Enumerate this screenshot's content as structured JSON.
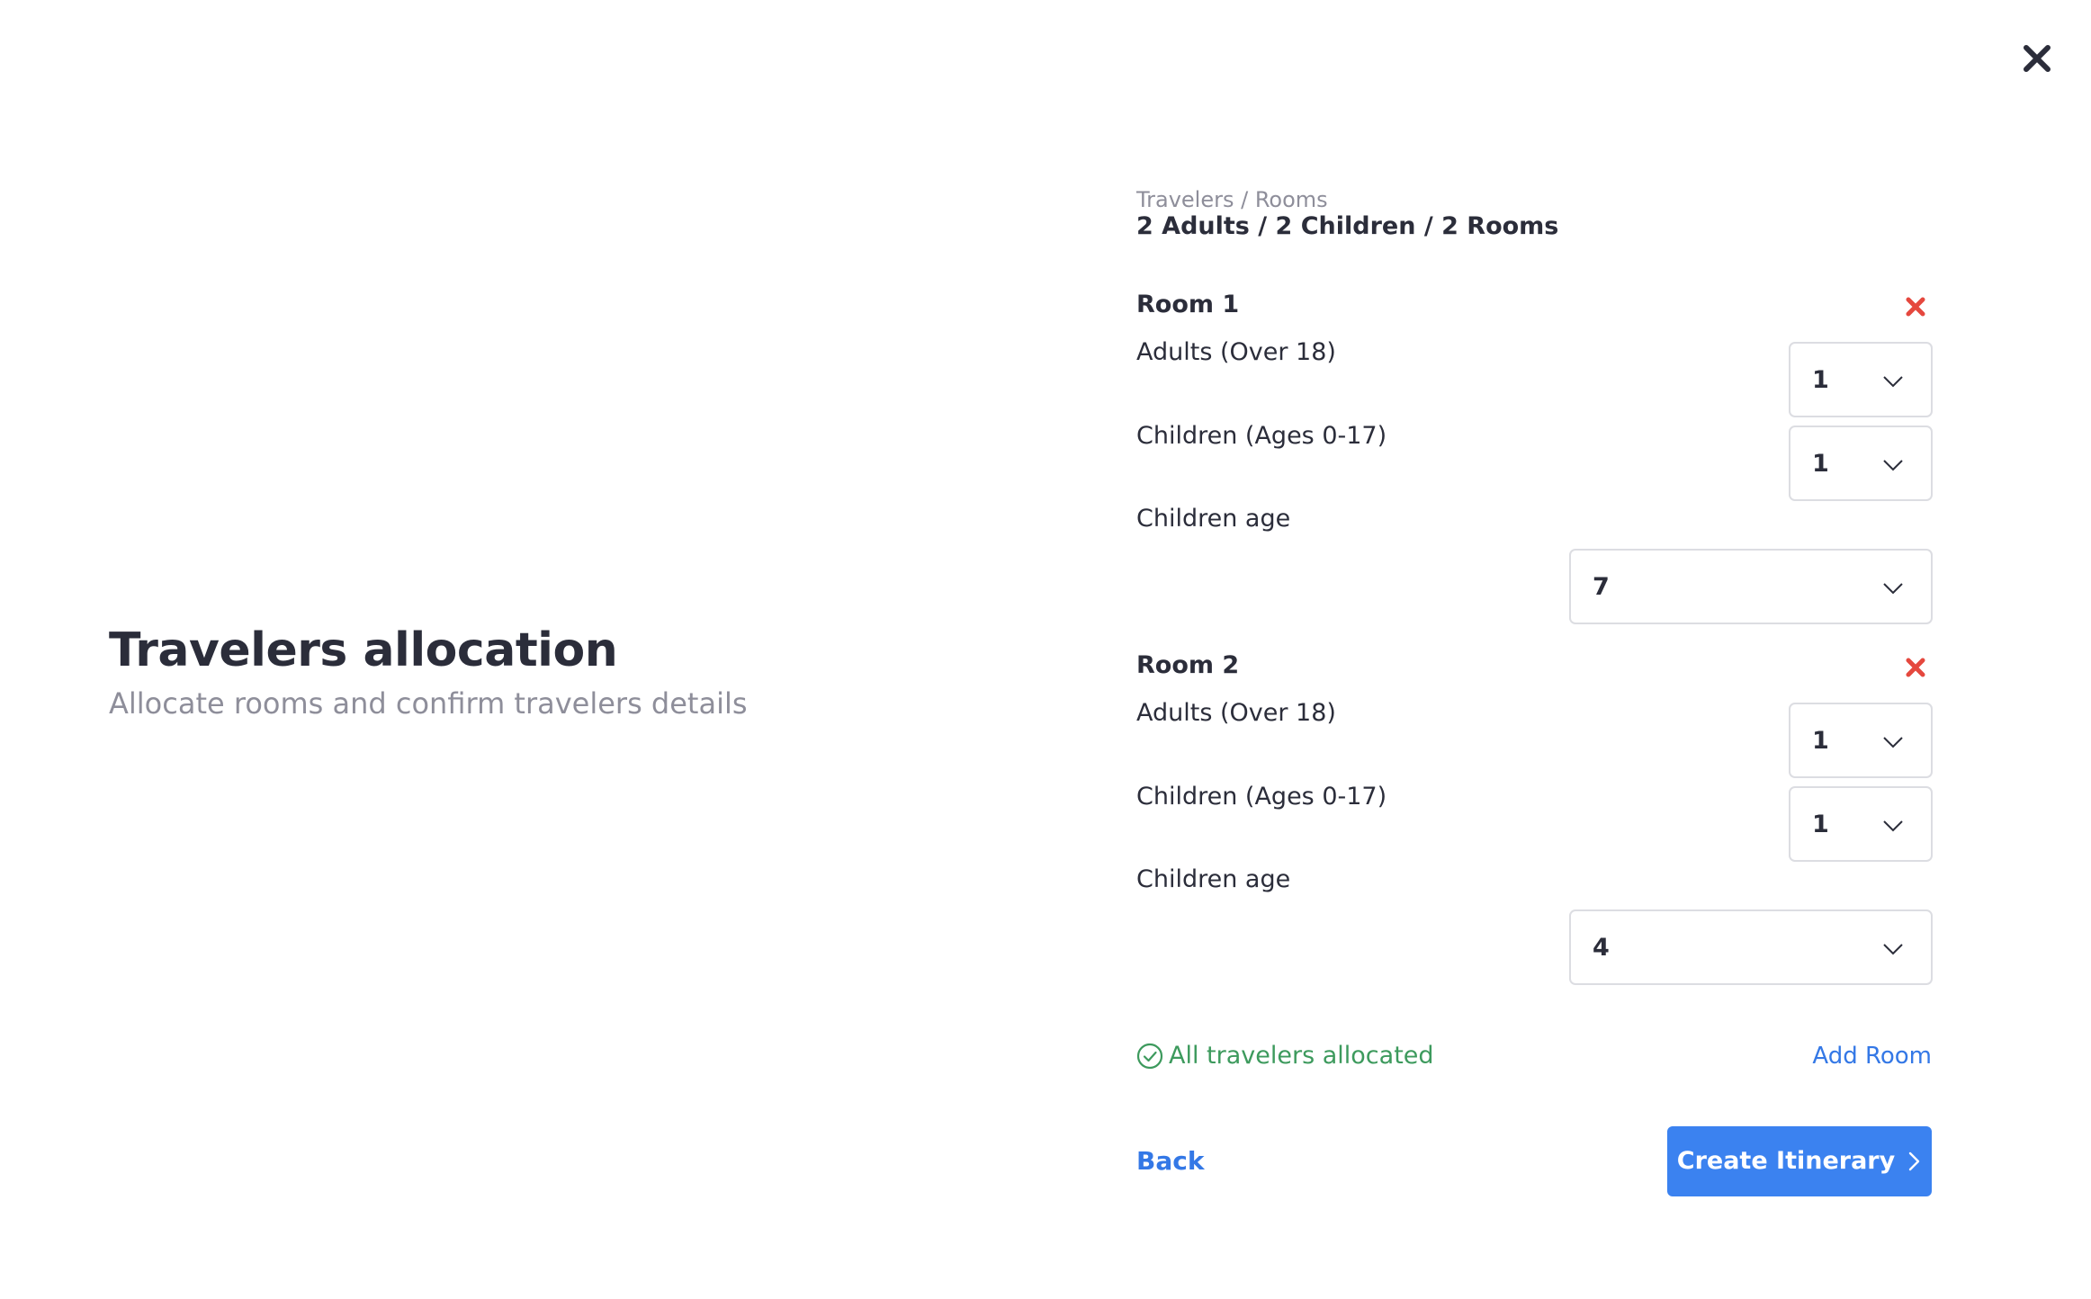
{
  "header": {
    "close_icon": "close-icon"
  },
  "intro": {
    "title": "Travelers allocation",
    "subtitle": "Allocate rooms and confirm travelers details"
  },
  "summary": {
    "label": "Travelers / Rooms",
    "value": "2 Adults / 2 Children / 2 Rooms"
  },
  "rooms": [
    {
      "title": "Room 1",
      "adults_label": "Adults (Over 18)",
      "adults_value": "1",
      "children_label": "Children (Ages 0-17)",
      "children_value": "1",
      "children_age_label": "Children age",
      "children_age_value": "7"
    },
    {
      "title": "Room 2",
      "adults_label": "Adults (Over 18)",
      "adults_value": "1",
      "children_label": "Children (Ages 0-17)",
      "children_value": "1",
      "children_age_label": "Children age",
      "children_age_value": "4"
    }
  ],
  "status": {
    "text": "All travelers allocated",
    "color": "#3d9a5d"
  },
  "actions": {
    "add_room": "Add Room",
    "back": "Back",
    "create": "Create Itinerary"
  },
  "colors": {
    "accent": "#3b82f0",
    "link": "#3478e6",
    "danger": "#e5483e",
    "text": "#2b2d3a",
    "muted": "#8e8e9a"
  }
}
